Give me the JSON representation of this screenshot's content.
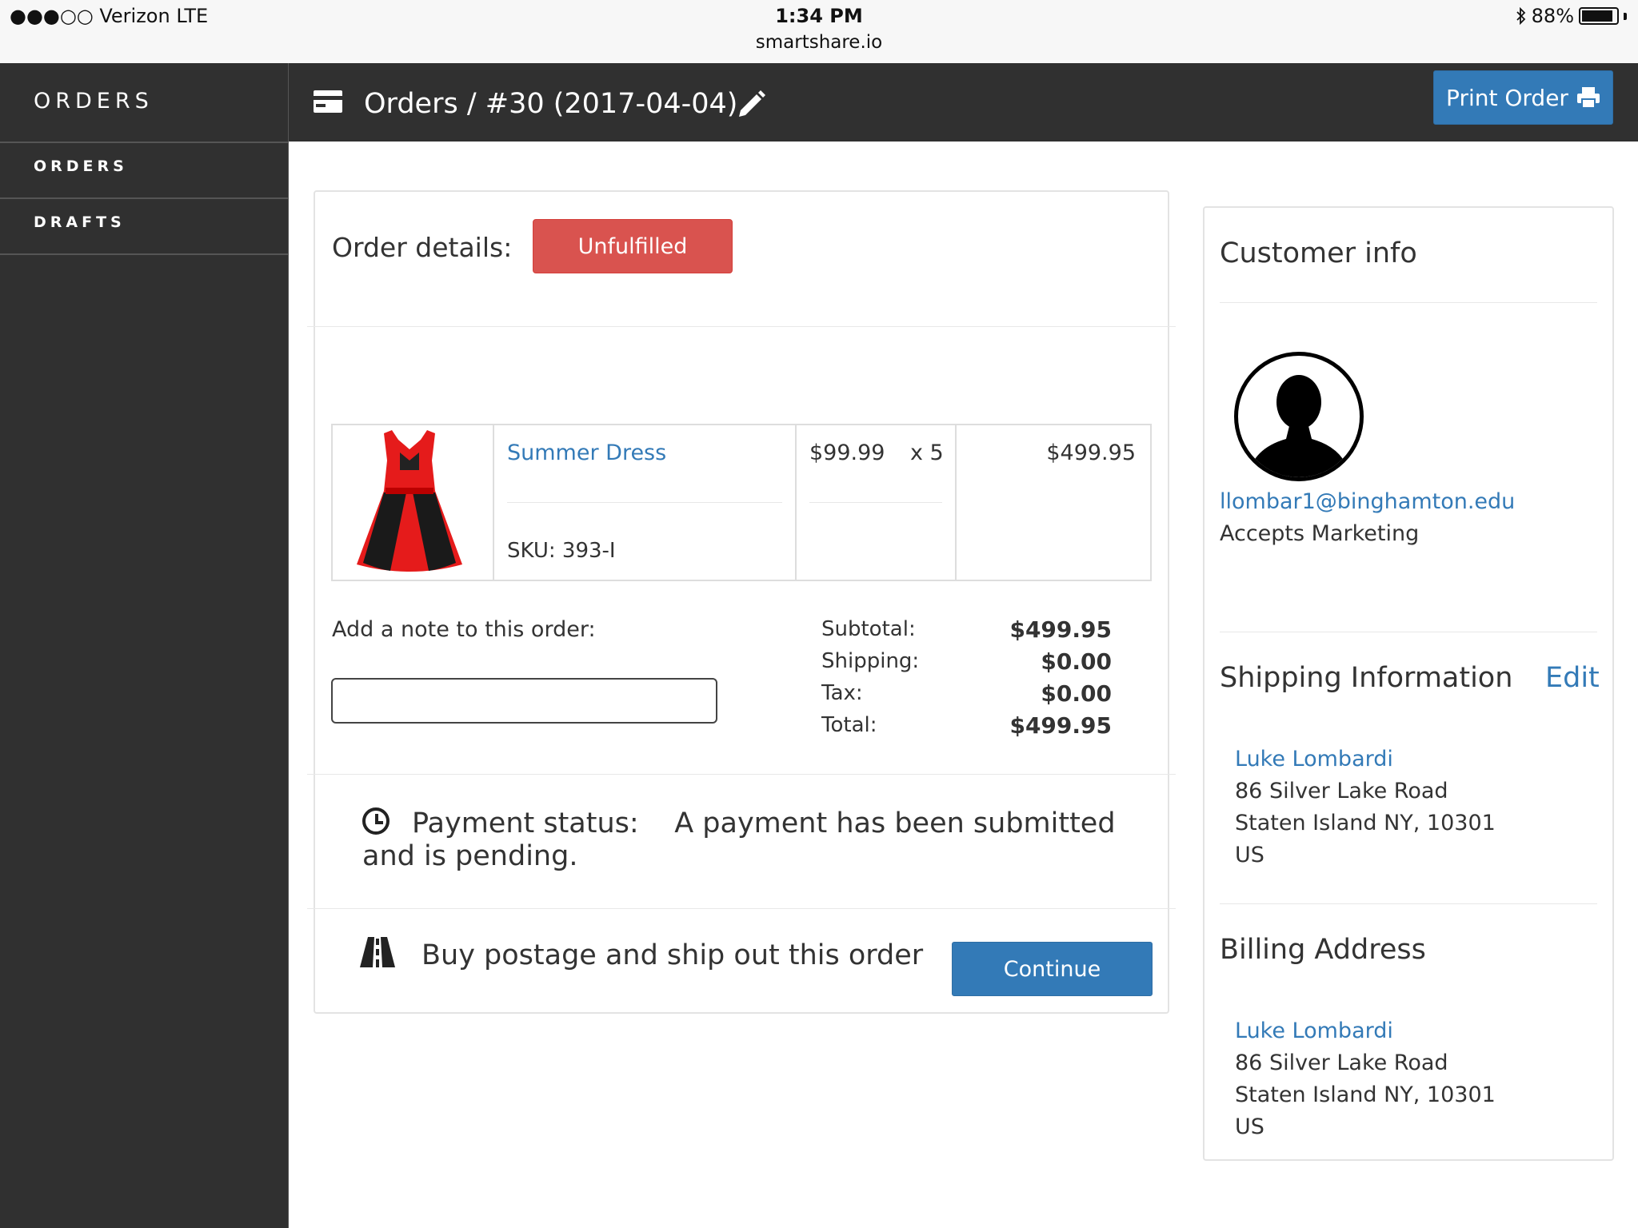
{
  "status_bar": {
    "carrier": "●●●○○ Verizon  LTE",
    "time": "1:34 PM",
    "url": "smartshare.io",
    "battery": "88%"
  },
  "sidebar": {
    "title": "ORDERS",
    "items": [
      {
        "label": "ORDERS"
      },
      {
        "label": "DRAFTS"
      }
    ]
  },
  "header": {
    "title": "Orders / #30  (2017-04-04)",
    "print_label": "Print Order"
  },
  "order": {
    "details_label": "Order details:",
    "status_badge": "Unfulfilled",
    "item": {
      "name": "Summer Dress",
      "sku": "SKU: 393-I",
      "price": "$99.99",
      "quantity": "x 5",
      "line_total": "$499.95"
    },
    "note_label": "Add a note to this order:",
    "note_value": "",
    "summary": [
      {
        "label": "Subtotal:",
        "value": "$499.95"
      },
      {
        "label": "Shipping:",
        "value": "$0.00"
      },
      {
        "label": "Tax:",
        "value": "$0.00"
      },
      {
        "label": "Total:",
        "value": "$499.95"
      }
    ],
    "payment_label": "Payment status:",
    "payment_message": "A payment has been submitted and is pending.",
    "ship_text": "Buy postage and ship out this order",
    "continue_label": "Continue"
  },
  "customer": {
    "title": "Customer info",
    "email": "llombar1@binghamton.edu",
    "marketing": "Accepts Marketing",
    "shipping": {
      "title": "Shipping Information",
      "edit_label": "Edit",
      "name": "Luke Lombardi",
      "line1": "86 Silver Lake Road",
      "line2": "Staten Island NY, 10301",
      "country": "US"
    },
    "billing": {
      "title": "Billing Address",
      "name": "Luke Lombardi",
      "line1": "86 Silver Lake Road",
      "line2": "Staten Island NY, 10301",
      "country": "US"
    }
  },
  "colors": {
    "dark": "#303030",
    "primary": "#337ab7",
    "danger": "#d9534f"
  }
}
